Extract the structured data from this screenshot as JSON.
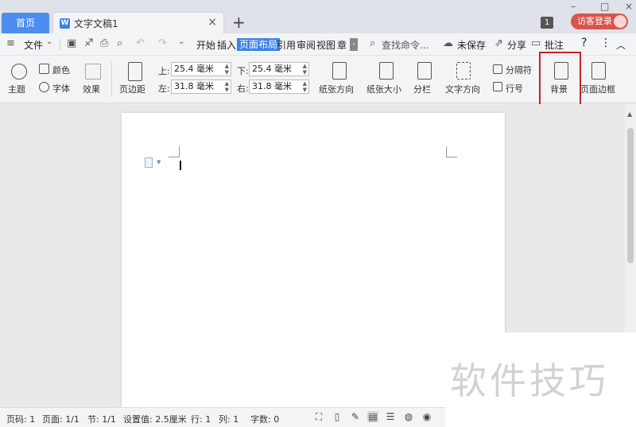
{
  "titlebar": {
    "home_tab": "首页",
    "doc_tab": "文字文稿1",
    "close_tab": "×",
    "add_tab": "+",
    "window_count": "1",
    "visitor_login": "访客登录",
    "minimize": "–",
    "maximize": "□",
    "close_window": "×"
  },
  "menubar": {
    "file": "文件",
    "tabs": [
      "开始",
      "插入",
      "页面布局",
      "引用",
      "审阅",
      "视图",
      "章"
    ],
    "active_tab": "页面布局",
    "search": "查找命令...",
    "unsaved": "未保存",
    "share": "分享",
    "comment": "批注",
    "help": "?",
    "more": "⋮",
    "collapse": "︿"
  },
  "ribbon": {
    "theme": "主题",
    "colors": "颜色",
    "font": "字体",
    "effects": "效果",
    "margins": "页边距",
    "top_label": "上:",
    "top_value": "25.4 毫米",
    "bottom_label": "下:",
    "bottom_value": "25.4 毫米",
    "left_label": "左:",
    "left_value": "31.8 毫米",
    "right_label": "右:",
    "right_value": "31.8 毫米",
    "orientation": "纸张方向",
    "size": "纸张大小",
    "columns": "分栏",
    "text_direction": "文字方向",
    "breaks": "分隔符",
    "line_numbers": "行号",
    "background": "背景",
    "page_border": "页面边框"
  },
  "statusbar": {
    "page_num": "页码: 1",
    "pages": "页面: 1/1",
    "section": "节: 1/1",
    "setting": "设置值: 2.5厘米",
    "row": "行: 1",
    "col": "列: 1",
    "words": "字数: 0"
  },
  "watermark": "软件技巧",
  "colors": {
    "accent": "#3c83e6",
    "highlight_box": "#c0262d",
    "visitor_button": "#d9534f"
  }
}
